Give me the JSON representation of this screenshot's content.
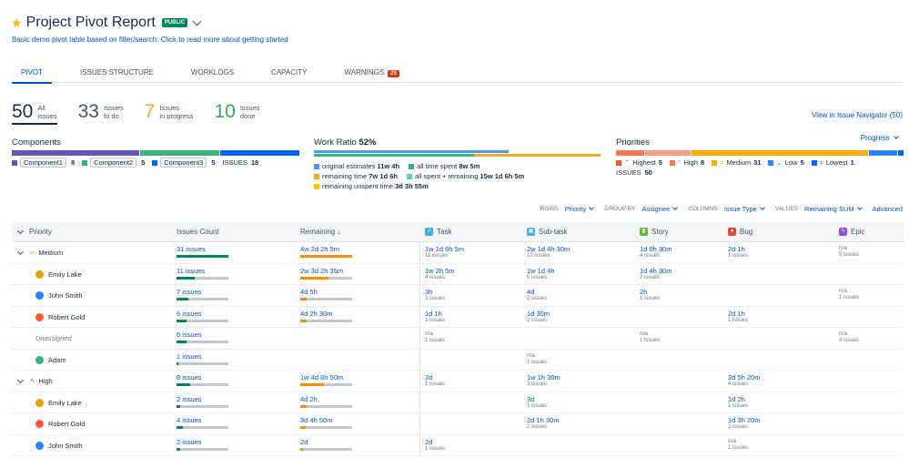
{
  "header": {
    "title": "Project Pivot Report",
    "badge": "PUBLIC",
    "subtitle": "Basic demo pivot table based on filter/search. Click to read more about getting started"
  },
  "tabs": [
    {
      "label": "PIVOT",
      "active": true
    },
    {
      "label": "ISSUES STRUCTURE"
    },
    {
      "label": "WORKLOGS"
    },
    {
      "label": "CAPACITY"
    },
    {
      "label": "WARNINGS",
      "badge": "25"
    }
  ],
  "stats": [
    {
      "num": "50",
      "l1": "All",
      "l2": "issues",
      "color": "#172b4d"
    },
    {
      "num": "33",
      "l1": "Issues",
      "l2": "to do",
      "color": "#42526e"
    },
    {
      "num": "7",
      "l1": "Issues",
      "l2": "in progress",
      "color": "#f5a623"
    },
    {
      "num": "10",
      "l1": "Issues",
      "l2": "done",
      "color": "#36a852"
    }
  ],
  "nav_link": "View in Issue Navigator (50)",
  "components": {
    "title": "Components",
    "items": [
      {
        "name": "Component1",
        "count": "8",
        "color": "#6554c0"
      },
      {
        "name": "Component2",
        "count": "5",
        "color": "#36b37e"
      },
      {
        "name": "Component3",
        "count": "5",
        "color": "#0065ff"
      }
    ],
    "issues_label": "ISSUES",
    "issues_count": "18"
  },
  "work_ratio": {
    "title": "Work Ratio",
    "pct": "52%",
    "row1": [
      {
        "label": "original estimates",
        "value": "11w 4h",
        "color": "#4c9aff"
      },
      {
        "label": "all time spent",
        "value": "8w 5m",
        "color": "#36b37e"
      }
    ],
    "row2": [
      {
        "label": "remaining time",
        "value": "7w 1d 6h",
        "color": "#f5a623"
      },
      {
        "label": "all spent + remaining",
        "value": "15w 1d 6h 5m",
        "color": "#57d9a3"
      }
    ],
    "row3": [
      {
        "label": "remaining unspent time",
        "value": "3d 3h 55m",
        "color": "#ffc400"
      }
    ]
  },
  "priorities": {
    "title": "Priorities",
    "dropdown": "Progress",
    "items": [
      {
        "name": "Highest",
        "count": "5",
        "color": "#ff5630",
        "icon": "highest-priority-icon",
        "glyph": "⌃"
      },
      {
        "name": "High",
        "count": "8",
        "color": "#ff7452",
        "icon": "high-priority-icon",
        "glyph": "^"
      },
      {
        "name": "Medium",
        "count": "31",
        "color": "#ffab00",
        "icon": "medium-priority-icon",
        "glyph": "="
      },
      {
        "name": "Low",
        "count": "5",
        "color": "#2684ff",
        "icon": "low-priority-icon",
        "glyph": "⌄"
      },
      {
        "name": "Lowest",
        "count": "1",
        "color": "#0065ff",
        "icon": "lowest-priority-icon",
        "glyph": "≈"
      }
    ],
    "issues_label": "ISSUES",
    "issues_count": "50"
  },
  "controls": {
    "rows_label": "ROWS",
    "rows_value": "Priority",
    "group_label": "GROUP BY",
    "group_value": "Assignee",
    "columns_label": "COLUMNS",
    "columns_value": "Issue Type",
    "values_label": "VALUES",
    "values_value": "Remaining SUM",
    "advanced": "Advanced"
  },
  "table": {
    "headers": {
      "priority": "Priority",
      "issues_count": "Issues Count",
      "remaining": "Remaining ↓",
      "task": "Task",
      "subtask": "Sub-task",
      "story": "Story",
      "bug": "Bug",
      "epic": "Epic"
    },
    "rows": [
      {
        "type": "group",
        "label": "Medium",
        "icon": "medium-priority-icon",
        "glyph": "=",
        "gcolor": "#ffab00",
        "count": "31 issues",
        "countFill": 1.0,
        "remaining": "4w 2d 2h 5m",
        "remFill": 1.0,
        "task": [
          "1w 1d 6h 5m",
          "11 issues"
        ],
        "subtask": [
          "2w 1d 4h 30m",
          "10 issues"
        ],
        "story": [
          "1d 6h 30m",
          "4 issues"
        ],
        "bug": [
          "2d 1h",
          "1 issues"
        ],
        "epic": [
          "n/a",
          "5 issues"
        ]
      },
      {
        "type": "person",
        "label": "Emily Lake",
        "avatar": "#e5a000",
        "count": "11 issues",
        "countFill": 0.35,
        "remaining": "2w 3d 2h 35m",
        "remFill": 0.55,
        "task": [
          "1w 2h 5m",
          "4 issues"
        ],
        "subtask": [
          "1w 1d 4h",
          "5 issues"
        ],
        "story": [
          "1d 4h 30m",
          "2 issues"
        ],
        "bug": null,
        "epic": null
      },
      {
        "type": "person",
        "label": "John Smith",
        "avatar": "#2684ff",
        "count": "7 issues",
        "countFill": 0.23,
        "remaining": "4d 5h",
        "remFill": 0.12,
        "task": [
          "3h",
          "3 issues"
        ],
        "subtask": [
          "4d",
          "2 issues"
        ],
        "story": [
          "2h",
          "1 issues"
        ],
        "bug": null,
        "epic": [
          "n/a",
          "1 issues"
        ]
      },
      {
        "type": "person",
        "label": "Robert Gold",
        "avatar": "#ff5630",
        "count": "6 issues",
        "countFill": 0.2,
        "remaining": "4d 2h 30m",
        "remFill": 0.12,
        "task": [
          "1d 1h",
          "1 issues"
        ],
        "subtask": [
          "1d 30m",
          "2 issues"
        ],
        "story": null,
        "bug": [
          "2d 1h",
          "1 issues"
        ],
        "epic": null
      },
      {
        "type": "unassigned",
        "label": "Unassigned",
        "count": "6 issues",
        "countFill": 0.2,
        "remaining": "",
        "remFill": 0,
        "task": [
          "n/a",
          "1 issues"
        ],
        "subtask": null,
        "story": [
          "n/a",
          "1 issues"
        ],
        "bug": null,
        "epic": [
          "n/a",
          "4 issues"
        ]
      },
      {
        "type": "person",
        "label": "Adam",
        "avatar": "#36b37e",
        "count": "1 issues",
        "countFill": 0.04,
        "remaining": "",
        "remFill": 0,
        "task": null,
        "subtask": [
          "n/a",
          "1 issues"
        ],
        "story": null,
        "bug": null,
        "epic": null
      },
      {
        "type": "group",
        "label": "High",
        "icon": "high-priority-icon",
        "glyph": "^",
        "gcolor": "#ff5630",
        "count": "8 issues",
        "countFill": 0.26,
        "remaining": "1w 4d 6h 50m",
        "remFill": 0.45,
        "task": [
          "2d",
          "1 issues"
        ],
        "subtask": [
          "1w 1h 30m",
          "3 issues"
        ],
        "story": null,
        "bug": [
          "2d 5h 20m",
          "4 issues"
        ],
        "epic": null
      },
      {
        "type": "person",
        "label": "Emily Lake",
        "avatar": "#e5a000",
        "count": "2 issues",
        "countFill": 0.07,
        "remaining": "4d 2h",
        "remFill": 0.12,
        "task": null,
        "subtask": [
          "3d",
          "1 issues"
        ],
        "story": null,
        "bug": [
          "1d 2h",
          "1 issues"
        ],
        "epic": null
      },
      {
        "type": "person",
        "label": "Robert Gold",
        "avatar": "#ff5630",
        "count": "4 issues",
        "countFill": 0.13,
        "remaining": "3d 4h 50m",
        "remFill": 0.1,
        "task": null,
        "subtask": [
          "2d 1h 30m",
          "2 issues"
        ],
        "story": null,
        "bug": [
          "1d 3h 20m",
          "2 issues"
        ],
        "epic": null
      },
      {
        "type": "person",
        "label": "John Smith",
        "avatar": "#2684ff",
        "count": "2 issues",
        "countFill": 0.07,
        "remaining": "2d",
        "remFill": 0.05,
        "task": [
          "2d",
          "1 issues"
        ],
        "subtask": null,
        "story": null,
        "bug": [
          "n/a",
          "1 issues"
        ],
        "epic": null
      }
    ]
  }
}
